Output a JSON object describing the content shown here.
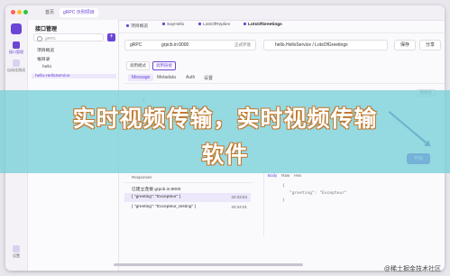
{
  "titlebar": {
    "tabs": [
      "首页",
      "gRPC 示例项目"
    ]
  },
  "rail": {
    "items": [
      "接口管理",
      "自动化测试",
      "设置"
    ]
  },
  "tree": {
    "title": "接口管理",
    "search_placeholder": "gRPC",
    "add_label": "+",
    "rows": [
      "项目概览",
      "根目录",
      "hello",
      "hello.HelloService"
    ]
  },
  "main": {
    "tabs": [
      "项目概览",
      "SayHello",
      "LotsOfReplies",
      "LotsOfGreetings"
    ],
    "request": {
      "protocol": "gRPC",
      "url": "grpcb.in:9000",
      "env": "正式环境",
      "method": "hello.HelloService / LotsOfGreetings",
      "save": "保存",
      "share": "分享"
    },
    "modes": [
      "调用模式",
      "调用链接"
    ],
    "subtabs": [
      "Message",
      "Metadata",
      "Auth",
      "设置"
    ],
    "tool_right": "格式化",
    "code": [
      "{",
      "\"greeting\": \"Excepteur\"",
      "}"
    ],
    "send_label": "开始",
    "response": {
      "header": "Responses",
      "rows": [
        {
          "msg": "已建立连接 grpcb.in:9000",
          "time": ""
        },
        {
          "msg": "{ \"greeting\": \"Excepteur\" }",
          "time": "20:33:53"
        },
        {
          "msg": "{ \"greeting\": \"Excepteur_testing\" }",
          "time": "20:34:01"
        }
      ]
    },
    "detail": {
      "tabs": [
        "Body",
        "Raw",
        "Hex"
      ],
      "code": [
        "{",
        "\"greeting\": \"Excepteur\"",
        "}"
      ]
    }
  },
  "overlay": {
    "line1": "实时视频传输，实时视频传输",
    "line2": "软件",
    "watermark": "@稀土掘金技术社区"
  },
  "colors": {
    "accent": "#6b45d6",
    "banner": "#78d0d8"
  }
}
